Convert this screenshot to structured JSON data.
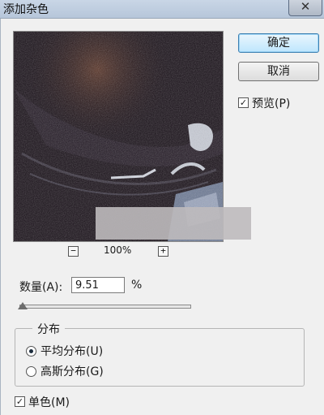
{
  "window": {
    "title": "添加杂色",
    "close_glyph": "✕"
  },
  "buttons": {
    "ok_label": "确定",
    "cancel_label": "取消"
  },
  "preview_checkbox": {
    "label": "预览(P)",
    "checked": true
  },
  "zoom": {
    "zoom_out": "−",
    "zoom_in": "+",
    "value": "100%"
  },
  "amount": {
    "label": "数量(A):",
    "value": "9.51",
    "unit": "%",
    "slider_fraction": 0.02
  },
  "distribution": {
    "legend": "分布",
    "options": [
      {
        "label": "平均分布(U)",
        "selected": true
      },
      {
        "label": "高斯分布(G)",
        "selected": false
      }
    ]
  },
  "monochromatic": {
    "label": "单色(M)",
    "checked": true
  },
  "icons": {
    "check_glyph": "✓"
  }
}
